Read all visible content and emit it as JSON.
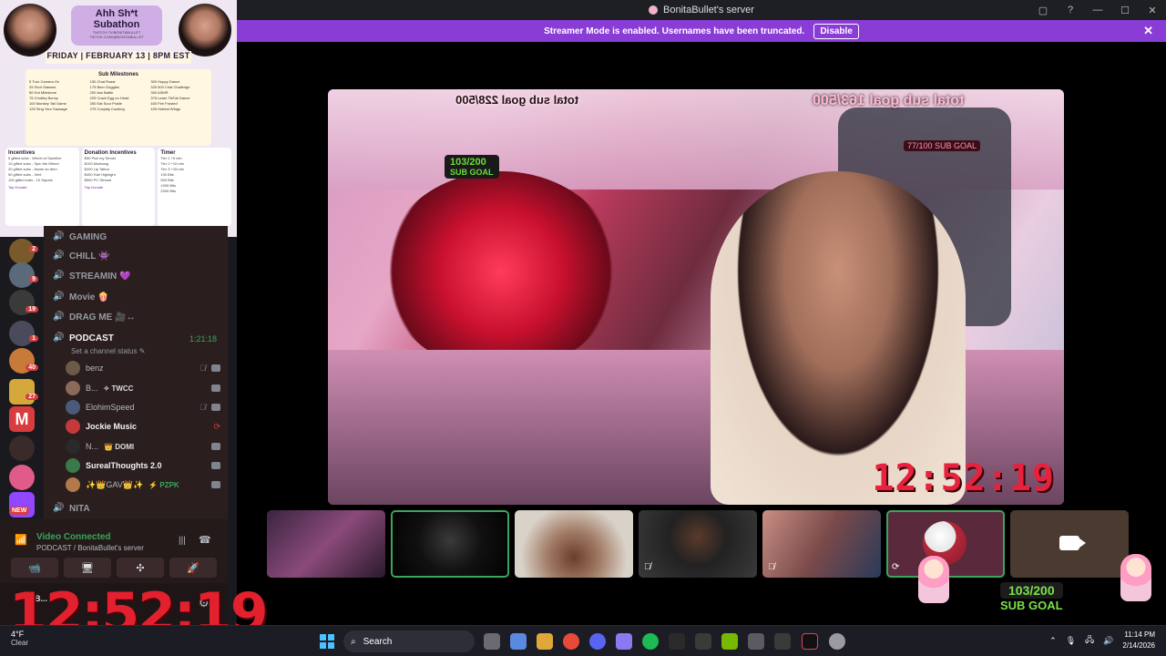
{
  "window": {
    "title": "BonitaBullet's server",
    "controls": [
      "▢",
      "?",
      "—",
      "☐",
      "✕"
    ]
  },
  "banner": {
    "text": "Streamer Mode is enabled. Usernames have been truncated.",
    "button_label": "Disable",
    "close": "✕"
  },
  "subathon": {
    "title": "Ahh Sh*t Subathon",
    "links": [
      "TWITCH.TV/BONITABULLET",
      "TIKTOK.COM/@BONITABULLET"
    ],
    "date": "FRIDAY | FEBRUARY 13 | 8PM EST",
    "milestones_title": "Sub Milestones",
    "milestones": [
      [
        "5 Turn Camera On",
        "25 Shot Glasses",
        "50 Hot Milestone",
        "75 Chubby Bunny",
        "100 Monkey Tail Game",
        "125 Sing Your Sausage"
      ],
      [
        "150 Chat Roast",
        "175 Beer Goggles",
        "200 Ass Battle",
        "225 Crack Egg on Head",
        "250 Eat Sour Pickle",
        "275 Cosplay Cooking"
      ],
      [
        "300 Hoppy Dance",
        "325 500 Chat Challenge",
        "350 ASMR",
        "375 Learn TikTok Dance",
        "400 Fire Frosted",
        "425 Hottest Wings"
      ]
    ],
    "incentives_title": "Incentives",
    "incentives": [
      "5 gifted subs - Wheel of Sacrifice",
      "10 gifted subs - Spin the Wheel",
      "20 gifted subs - Name an Item",
      "50 gifted subs - Vent",
      "100 gifted subs - 10 Squats"
    ],
    "donation_title": "Donation Incentives",
    "donations": [
      "$50 Pick my Dinner",
      "$100 Mukbang",
      "$200 Lip Tattoo",
      "$400 Hair Highlight",
      "$500 PC Stream"
    ],
    "timer_title": "Timer",
    "timer_lines": [
      "Tier 1 +5 min",
      "Tier 2 +10 min",
      "Tier 3 +15 min",
      "100 Bits",
      "500 Bits",
      "1000 Bits",
      "2000 Bits"
    ],
    "cta": "Tap Donate"
  },
  "channels": [
    {
      "name": "GAMING",
      "icon": "🔊",
      "live": false
    },
    {
      "name": "CHILL 👾",
      "icon": "🔊",
      "live": false
    },
    {
      "name": "STREAMIN 💜",
      "icon": "🔊",
      "live": false
    },
    {
      "name": "Movie 🍿",
      "icon": "🔊",
      "live": false
    },
    {
      "name": "DRAG ME 🎥↔",
      "icon": "🔊",
      "live": false
    },
    {
      "name": "PODCAST",
      "icon": "🔊",
      "live": true
    },
    {
      "name": "NITA",
      "icon": "🔊",
      "live": false
    }
  ],
  "podcast": {
    "elapsed": "1:21:18",
    "status_placeholder": "Set a channel status ✎"
  },
  "voice_users": [
    {
      "name": "benz",
      "tag": "",
      "bright": false,
      "muted": true,
      "color": "#6b5a4a"
    },
    {
      "name": "B...",
      "tag": "✧ TWCC",
      "bright": false,
      "muted": false,
      "color": "#8a6a5a"
    },
    {
      "name": "ElohimSpeed",
      "tag": "",
      "bright": false,
      "muted": true,
      "color": "#4a5a7a"
    },
    {
      "name": "Jockie Music",
      "tag": "",
      "bright": true,
      "muted": false,
      "color": "#c43a3a"
    },
    {
      "name": "N...",
      "tag": "👑 DOMI",
      "bright": false,
      "muted": false,
      "color": "#2a2a2a"
    },
    {
      "name": "SurealThoughts 2.0",
      "tag": "",
      "bright": true,
      "muted": false,
      "color": "#3a7a4a"
    },
    {
      "name": "✨👑GAV👑✨",
      "tag": "⚡ PZPK",
      "bright": false,
      "muted": false,
      "color": "#b07a4a"
    }
  ],
  "rail_badges": [
    "2",
    "9",
    "19",
    "1",
    "40",
    "27",
    "NEW"
  ],
  "voice": {
    "status": "Video Connected",
    "channel": "PODCAST / BonitaBullet's server",
    "buttons": [
      "📹",
      "🖥",
      "✣",
      "🚀"
    ]
  },
  "userbar": {
    "name": "B..."
  },
  "overlay_timer": "12:52:19",
  "stream": {
    "timer": "12:52:19",
    "sub_badge": "103/200",
    "sub_goal_label": "SUB GOAL",
    "mirrored_goal_1": "total sub goal 228/500",
    "mirrored_goal_2": "total sub goal 163/500",
    "small_badge": "77/100 SUB GOAL"
  },
  "sub_goal": {
    "count": "103/200",
    "label": "SUB GOAL"
  },
  "tiles": [
    {
      "muted": false,
      "active": false
    },
    {
      "muted": false,
      "active": true
    },
    {
      "muted": false,
      "active": false
    },
    {
      "muted": true,
      "active": false
    },
    {
      "muted": true,
      "active": false
    },
    {
      "muted": false,
      "active": true
    },
    {
      "muted": false,
      "active": false
    }
  ],
  "taskbar": {
    "weather_temp": "4°F",
    "weather_cond": "Clear",
    "search_placeholder": "Search",
    "time": "11:14 PM",
    "date": "2/14/2026"
  }
}
